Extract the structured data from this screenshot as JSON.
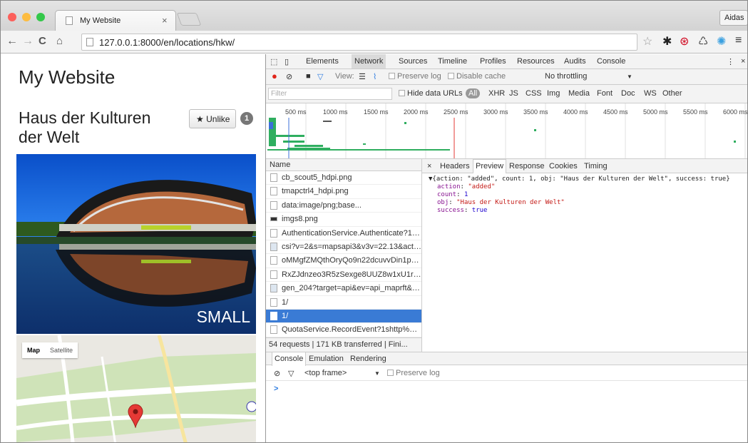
{
  "browser": {
    "tab_title": "My Website",
    "tab_close": "×",
    "profile_name": "Aidas",
    "url": "127.0.0.1:8000/en/locations/hkw/"
  },
  "page": {
    "site_title": "My Website",
    "location_title": "Haus der Kulturen der Welt",
    "unlike_label": "Unlike",
    "unlike_count": "1",
    "photo_caption": "SMALL",
    "map_type_map": "Map",
    "map_type_satellite": "Satellite"
  },
  "devtools": {
    "tabs": [
      "Elements",
      "Network",
      "Sources",
      "Timeline",
      "Profiles",
      "Resources",
      "Audits",
      "Console"
    ],
    "view_label": "View:",
    "preserve_log": "Preserve log",
    "disable_cache": "Disable cache",
    "throttling": "No throttling",
    "filter_placeholder": "Filter",
    "hide_data_urls": "Hide data URLs",
    "filter_types": [
      "All",
      "XHR",
      "JS",
      "CSS",
      "Img",
      "Media",
      "Font",
      "Doc",
      "WS",
      "Other"
    ],
    "timeline_ticks": [
      "500 ms",
      "1000 ms",
      "1500 ms",
      "2000 ms",
      "2500 ms",
      "3000 ms",
      "3500 ms",
      "4000 ms",
      "4500 ms",
      "5000 ms",
      "5500 ms",
      "6000 ms"
    ],
    "name_header": "Name",
    "requests": [
      "cb_scout5_hdpi.png",
      "tmapctrl4_hdpi.png",
      "data:image/png;base...",
      "imgs8.png",
      "AuthenticationService.Authenticate?1s...",
      "csi?v=2&s=mapsapi3&v3v=22.13&acti...",
      "oMMgfZMQthOryQo9n22dcuvvDin1pK...",
      "RxZJdnzeo3R5zSexge8UUZ8w1xU1rKp...",
      "gen_204?target=api&ev=api_maprft&c...",
      "1/",
      "1/",
      "QuotaService.RecordEvent?1shttp%3A%..."
    ],
    "summary": "54 requests | 171 KB transferred | Fini...",
    "detail_tabs": [
      "×",
      "Headers",
      "Preview",
      "Response",
      "Cookies",
      "Timing"
    ],
    "preview_summary": "{action: \"added\", count: 1, obj: \"Haus der Kulturen der Welt\", success: true}",
    "preview_fields": [
      {
        "key": "action",
        "value": "\"added\"",
        "kind": "s"
      },
      {
        "key": "count",
        "value": "1",
        "kind": "n"
      },
      {
        "key": "obj",
        "value": "\"Haus der Kulturen der Welt\"",
        "kind": "s"
      },
      {
        "key": "success",
        "value": "true",
        "kind": "n"
      }
    ],
    "console_tabs": [
      "Console",
      "Emulation",
      "Rendering"
    ],
    "top_frame": "<top frame>",
    "console_preserve_log": "Preserve log",
    "prompt": ">"
  }
}
